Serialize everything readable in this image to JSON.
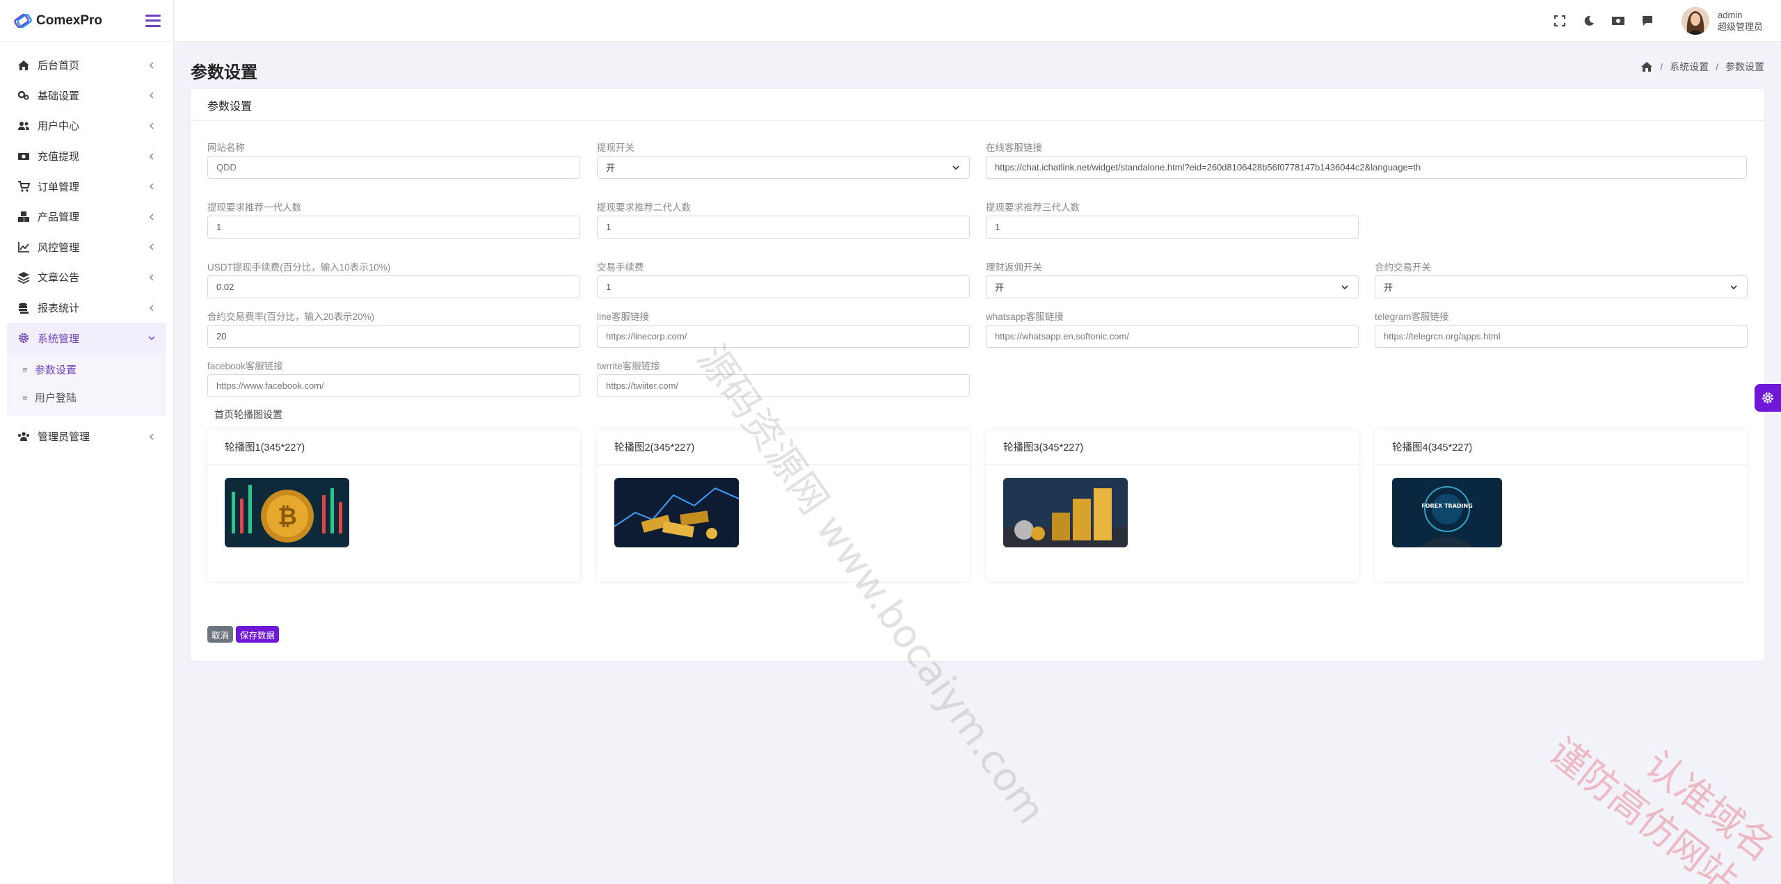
{
  "app": {
    "name": "ComexPro"
  },
  "sidebar": {
    "items": [
      {
        "label": "后台首页",
        "icon": "home-icon"
      },
      {
        "label": "基础设置",
        "icon": "cogs-icon"
      },
      {
        "label": "用户中心",
        "icon": "users-icon"
      },
      {
        "label": "充值提现",
        "icon": "money-icon"
      },
      {
        "label": "订单管理",
        "icon": "cart-icon"
      },
      {
        "label": "产品管理",
        "icon": "cubes-icon"
      },
      {
        "label": "风控管理",
        "icon": "chart-line-icon"
      },
      {
        "label": "文章公告",
        "icon": "layers-icon"
      },
      {
        "label": "报表统计",
        "icon": "coins-icon"
      },
      {
        "label": "系统管理",
        "icon": "gear-icon"
      }
    ],
    "sub_items": [
      {
        "label": "参数设置"
      },
      {
        "label": "用户登陆"
      }
    ],
    "last_item": {
      "label": "管理员管理",
      "icon": "user-group-icon"
    }
  },
  "topbar": {
    "icons": [
      "fullscreen-icon",
      "moon-icon",
      "cash-icon",
      "comment-icon"
    ],
    "user_name": "admin",
    "user_role": "超级管理员"
  },
  "page": {
    "title": "参数设置"
  },
  "breadcrumb": {
    "items": [
      "系统设置",
      "参数设置"
    ]
  },
  "card": {
    "title": "参数设置"
  },
  "form": {
    "site_name": {
      "label": "网站名称",
      "placeholder": "QDD"
    },
    "withdraw_switch": {
      "label": "提现开关",
      "value": "开"
    },
    "cs_link": {
      "label": "在线客服链接",
      "value": "https://chat.ichatlink.net/widget/standalone.html?eid=260d8106428b56f0778147b1436044c2&language=th"
    },
    "ref1": {
      "label": "提现要求推荐一代人数",
      "value": "1"
    },
    "ref2": {
      "label": "提现要求推荐二代人数",
      "value": "1"
    },
    "ref3": {
      "label": "提现要求推荐三代人数",
      "value": "1"
    },
    "usdt_fee": {
      "label": "USDT提现手续费(百分比，输入10表示10%)",
      "value": "0.02"
    },
    "trade_fee": {
      "label": "交易手续费",
      "value": "1"
    },
    "rebate_switch": {
      "label": "理财返佣开关",
      "value": "开"
    },
    "contract_switch": {
      "label": "合约交易开关",
      "value": "开"
    },
    "contract_rate": {
      "label": "合约交易费率(百分比，输入20表示20%)",
      "value": "20"
    },
    "line_link": {
      "label": "line客服链接",
      "placeholder": "https://linecorp.com/"
    },
    "whatsapp_link": {
      "label": "whatsapp客服链接",
      "placeholder": "https://whatsapp.en.softonic.com/"
    },
    "telegram_link": {
      "label": "telegram客服链接",
      "placeholder": "https://telegrcn.org/apps.html"
    },
    "facebook_link": {
      "label": "facebook客服链接",
      "placeholder": "https://www.facebook.com/"
    },
    "twitter_link": {
      "label": "twrrite客服链接",
      "placeholder": "https://twiiter.com/"
    }
  },
  "banners": {
    "title": "首页轮播图设置",
    "items": [
      {
        "label": "轮播图1(345*227)"
      },
      {
        "label": "轮播图2(345*227)"
      },
      {
        "label": "轮播图3(345*227)"
      },
      {
        "label": "轮播图4(345*227)",
        "image_text": "FOREX TRADING"
      }
    ]
  },
  "buttons": {
    "cancel": "取消",
    "save": "保存数据"
  },
  "watermarks": {
    "center": "源码资源网 www.bocaiym.com",
    "corner_line1": "认准域名",
    "corner_line2": "谨防高仿网站"
  },
  "colors": {
    "accent": "#6f18d8",
    "cancel": "#6c757d"
  }
}
